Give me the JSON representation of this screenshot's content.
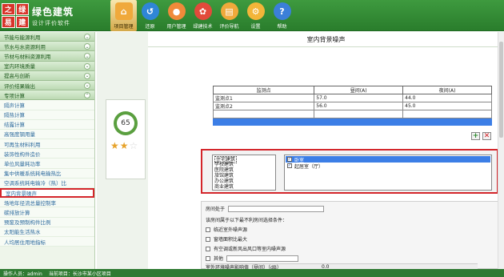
{
  "app": {
    "logo_chars": [
      "之",
      "绿",
      "易",
      "建"
    ],
    "title": "绿色建筑",
    "subtitle": "设计评价软件"
  },
  "nav": [
    {
      "label": "项目管理",
      "icon": "home-icon"
    },
    {
      "label": "还原",
      "icon": "undo-icon"
    },
    {
      "label": "用户管理",
      "icon": "user-icon"
    },
    {
      "label": "绿建技术",
      "icon": "tech-icon"
    },
    {
      "label": "评价导航",
      "icon": "eval-icon"
    },
    {
      "label": "设置",
      "icon": "gear-icon"
    },
    {
      "label": "帮助",
      "icon": "help-icon"
    }
  ],
  "sidebar": {
    "categories": [
      "节能与能源利用",
      "节水与水资源利用",
      "节材与材料资源利用",
      "室内环境质量",
      "提高与创新",
      "评价结果输出",
      "专项计算"
    ],
    "subitems": [
      "隔声计算",
      "隔热计算",
      "结露计算",
      "高强度钢用量",
      "可再生材料利用",
      "装饰性构件造价",
      "单位风量耗功率",
      "集中供暖系统耗电输热比",
      "空调系统耗电输冷（热）比",
      "室内背景噪声",
      "场地年径流总量控制率",
      "碳排放计算",
      "预废及预制构件比例",
      "太阳能生活热水",
      "人均居住用地指标"
    ],
    "selected_index": 9
  },
  "main": {
    "title": "室内背景噪声",
    "score": "65",
    "stars_on": 2,
    "stars_total": 3,
    "table": {
      "headers": [
        "监测点",
        "昼间(A)",
        "夜间(A)"
      ],
      "rows": [
        [
          "监测点1",
          "57.0",
          "44.0"
        ],
        [
          "监测点2",
          "56.0",
          "45.0"
        ]
      ]
    },
    "add_label": "+",
    "delete_label": "✕",
    "building_types": [
      "住宅建筑",
      "学校建筑",
      "医院建筑",
      "旅馆建筑",
      "办公建筑",
      "商业建筑"
    ],
    "rooms": [
      {
        "label": "卧室",
        "checked": true,
        "selected": true
      },
      {
        "label": "起居室（厅）",
        "checked": true,
        "selected": false
      }
    ],
    "form": {
      "room_label": "房间处于",
      "condition_prompt": "该房间属于以下最不利房间选择条件：",
      "options": [
        "临近室外噪声源",
        "窗墙面积比最大",
        "有空调或新风出风口等室内噪声源",
        "其他"
      ],
      "result_label": "室外环境噪声影响值（昼间）（dB）",
      "result_value": "0.0"
    }
  },
  "status": {
    "operator": "操作人员：admin",
    "project": "当前项目：长沙市某小区项目"
  }
}
